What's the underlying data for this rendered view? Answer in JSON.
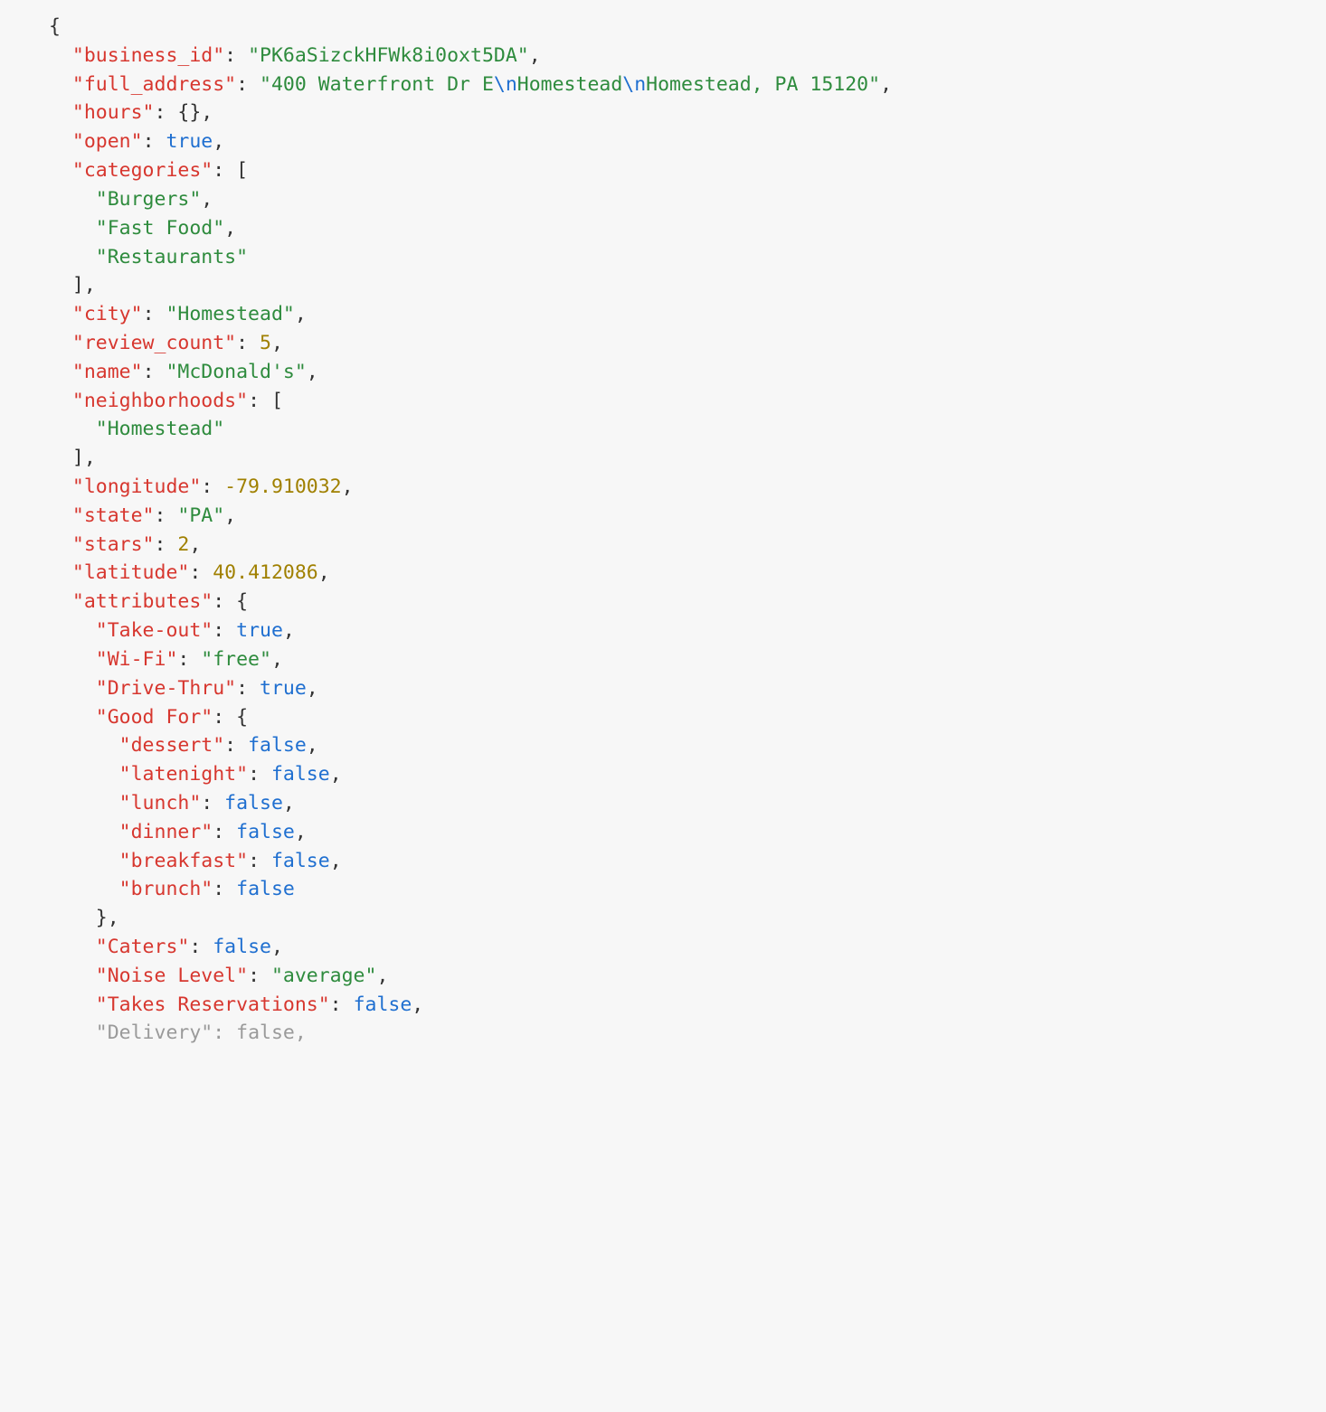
{
  "colors": {
    "punct": "#333333",
    "key": "#d7372f",
    "string": "#2e8b3d",
    "number": "#a08000",
    "boolean": "#1f6fd0",
    "escape": "#1f6fd0",
    "background": "#f7f7f7"
  },
  "json_data": {
    "business_id": "PK6aSizckHFWk8i0oxt5DA",
    "full_address": "400 Waterfront Dr E\nHomestead\nHomestead, PA 15120",
    "hours": {},
    "open": true,
    "categories": [
      "Burgers",
      "Fast Food",
      "Restaurants"
    ],
    "city": "Homestead",
    "review_count": 5,
    "name": "McDonald's",
    "neighborhoods": [
      "Homestead"
    ],
    "longitude": -79.910032,
    "state": "PA",
    "stars": 2,
    "latitude": 40.412086,
    "attributes": {
      "Take-out": true,
      "Wi-Fi": "free",
      "Drive-Thru": true,
      "Good For": {
        "dessert": false,
        "latenight": false,
        "lunch": false,
        "dinner": false,
        "breakfast": false,
        "brunch": false
      },
      "Caters": false,
      "Noise Level": "average",
      "Takes Reservations": false,
      "Delivery": false
    }
  },
  "tokens": [
    {
      "indent": 0,
      "parts": [
        {
          "t": "{",
          "c": "p"
        }
      ]
    },
    {
      "indent": 1,
      "parts": [
        {
          "t": "\"business_id\"",
          "c": "k"
        },
        {
          "t": ": ",
          "c": "p"
        },
        {
          "t": "\"PK6aSizckHFWk8i0oxt5DA\"",
          "c": "s"
        },
        {
          "t": ",",
          "c": "p"
        }
      ]
    },
    {
      "indent": 1,
      "parts": [
        {
          "t": "\"full_address\"",
          "c": "k"
        },
        {
          "t": ": ",
          "c": "p"
        },
        {
          "t": "\"400 Waterfront Dr E",
          "c": "s"
        },
        {
          "t": "\\n",
          "c": "e"
        },
        {
          "t": "Homestead",
          "c": "s"
        },
        {
          "t": "\\n",
          "c": "e"
        },
        {
          "t": "Homestead, PA 15120\"",
          "c": "s"
        },
        {
          "t": ",",
          "c": "p"
        }
      ]
    },
    {
      "indent": 1,
      "parts": [
        {
          "t": "\"hours\"",
          "c": "k"
        },
        {
          "t": ": ",
          "c": "p"
        },
        {
          "t": "{}",
          "c": "p"
        },
        {
          "t": ",",
          "c": "p"
        }
      ]
    },
    {
      "indent": 1,
      "parts": [
        {
          "t": "\"open\"",
          "c": "k"
        },
        {
          "t": ": ",
          "c": "p"
        },
        {
          "t": "true",
          "c": "b"
        },
        {
          "t": ",",
          "c": "p"
        }
      ]
    },
    {
      "indent": 1,
      "parts": [
        {
          "t": "\"categories\"",
          "c": "k"
        },
        {
          "t": ": ",
          "c": "p"
        },
        {
          "t": "[",
          "c": "p"
        }
      ]
    },
    {
      "indent": 2,
      "parts": [
        {
          "t": "\"Burgers\"",
          "c": "s"
        },
        {
          "t": ",",
          "c": "p"
        }
      ]
    },
    {
      "indent": 2,
      "parts": [
        {
          "t": "\"Fast Food\"",
          "c": "s"
        },
        {
          "t": ",",
          "c": "p"
        }
      ]
    },
    {
      "indent": 2,
      "parts": [
        {
          "t": "\"Restaurants\"",
          "c": "s"
        }
      ]
    },
    {
      "indent": 1,
      "parts": [
        {
          "t": "]",
          "c": "p"
        },
        {
          "t": ",",
          "c": "p"
        }
      ]
    },
    {
      "indent": 1,
      "parts": [
        {
          "t": "\"city\"",
          "c": "k"
        },
        {
          "t": ": ",
          "c": "p"
        },
        {
          "t": "\"Homestead\"",
          "c": "s"
        },
        {
          "t": ",",
          "c": "p"
        }
      ]
    },
    {
      "indent": 1,
      "parts": [
        {
          "t": "\"review_count\"",
          "c": "k"
        },
        {
          "t": ": ",
          "c": "p"
        },
        {
          "t": "5",
          "c": "n"
        },
        {
          "t": ",",
          "c": "p"
        }
      ]
    },
    {
      "indent": 1,
      "parts": [
        {
          "t": "\"name\"",
          "c": "k"
        },
        {
          "t": ": ",
          "c": "p"
        },
        {
          "t": "\"McDonald's\"",
          "c": "s"
        },
        {
          "t": ",",
          "c": "p"
        }
      ]
    },
    {
      "indent": 1,
      "parts": [
        {
          "t": "\"neighborhoods\"",
          "c": "k"
        },
        {
          "t": ": ",
          "c": "p"
        },
        {
          "t": "[",
          "c": "p"
        }
      ]
    },
    {
      "indent": 2,
      "parts": [
        {
          "t": "\"Homestead\"",
          "c": "s"
        }
      ]
    },
    {
      "indent": 1,
      "parts": [
        {
          "t": "]",
          "c": "p"
        },
        {
          "t": ",",
          "c": "p"
        }
      ]
    },
    {
      "indent": 1,
      "parts": [
        {
          "t": "\"longitude\"",
          "c": "k"
        },
        {
          "t": ": ",
          "c": "p"
        },
        {
          "t": "-79.910032",
          "c": "n"
        },
        {
          "t": ",",
          "c": "p"
        }
      ]
    },
    {
      "indent": 1,
      "parts": [
        {
          "t": "\"state\"",
          "c": "k"
        },
        {
          "t": ": ",
          "c": "p"
        },
        {
          "t": "\"PA\"",
          "c": "s"
        },
        {
          "t": ",",
          "c": "p"
        }
      ]
    },
    {
      "indent": 1,
      "parts": [
        {
          "t": "\"stars\"",
          "c": "k"
        },
        {
          "t": ": ",
          "c": "p"
        },
        {
          "t": "2",
          "c": "n"
        },
        {
          "t": ",",
          "c": "p"
        }
      ]
    },
    {
      "indent": 1,
      "parts": [
        {
          "t": "\"latitude\"",
          "c": "k"
        },
        {
          "t": ": ",
          "c": "p"
        },
        {
          "t": "40.412086",
          "c": "n"
        },
        {
          "t": ",",
          "c": "p"
        }
      ]
    },
    {
      "indent": 1,
      "parts": [
        {
          "t": "\"attributes\"",
          "c": "k"
        },
        {
          "t": ": ",
          "c": "p"
        },
        {
          "t": "{",
          "c": "p"
        }
      ]
    },
    {
      "indent": 2,
      "parts": [
        {
          "t": "\"Take-out\"",
          "c": "k"
        },
        {
          "t": ": ",
          "c": "p"
        },
        {
          "t": "true",
          "c": "b"
        },
        {
          "t": ",",
          "c": "p"
        }
      ]
    },
    {
      "indent": 2,
      "parts": [
        {
          "t": "\"Wi-Fi\"",
          "c": "k"
        },
        {
          "t": ": ",
          "c": "p"
        },
        {
          "t": "\"free\"",
          "c": "s"
        },
        {
          "t": ",",
          "c": "p"
        }
      ]
    },
    {
      "indent": 2,
      "parts": [
        {
          "t": "\"Drive-Thru\"",
          "c": "k"
        },
        {
          "t": ": ",
          "c": "p"
        },
        {
          "t": "true",
          "c": "b"
        },
        {
          "t": ",",
          "c": "p"
        }
      ]
    },
    {
      "indent": 2,
      "parts": [
        {
          "t": "\"Good For\"",
          "c": "k"
        },
        {
          "t": ": ",
          "c": "p"
        },
        {
          "t": "{",
          "c": "p"
        }
      ]
    },
    {
      "indent": 3,
      "parts": [
        {
          "t": "\"dessert\"",
          "c": "k"
        },
        {
          "t": ": ",
          "c": "p"
        },
        {
          "t": "false",
          "c": "b"
        },
        {
          "t": ",",
          "c": "p"
        }
      ]
    },
    {
      "indent": 3,
      "parts": [
        {
          "t": "\"latenight\"",
          "c": "k"
        },
        {
          "t": ": ",
          "c": "p"
        },
        {
          "t": "false",
          "c": "b"
        },
        {
          "t": ",",
          "c": "p"
        }
      ]
    },
    {
      "indent": 3,
      "parts": [
        {
          "t": "\"lunch\"",
          "c": "k"
        },
        {
          "t": ": ",
          "c": "p"
        },
        {
          "t": "false",
          "c": "b"
        },
        {
          "t": ",",
          "c": "p"
        }
      ]
    },
    {
      "indent": 3,
      "parts": [
        {
          "t": "\"dinner\"",
          "c": "k"
        },
        {
          "t": ": ",
          "c": "p"
        },
        {
          "t": "false",
          "c": "b"
        },
        {
          "t": ",",
          "c": "p"
        }
      ]
    },
    {
      "indent": 3,
      "parts": [
        {
          "t": "\"breakfast\"",
          "c": "k"
        },
        {
          "t": ": ",
          "c": "p"
        },
        {
          "t": "false",
          "c": "b"
        },
        {
          "t": ",",
          "c": "p"
        }
      ]
    },
    {
      "indent": 3,
      "parts": [
        {
          "t": "\"brunch\"",
          "c": "k"
        },
        {
          "t": ": ",
          "c": "p"
        },
        {
          "t": "false",
          "c": "b"
        }
      ]
    },
    {
      "indent": 2,
      "parts": [
        {
          "t": "}",
          "c": "p"
        },
        {
          "t": ",",
          "c": "p"
        }
      ]
    },
    {
      "indent": 2,
      "parts": [
        {
          "t": "\"Caters\"",
          "c": "k"
        },
        {
          "t": ": ",
          "c": "p"
        },
        {
          "t": "false",
          "c": "b"
        },
        {
          "t": ",",
          "c": "p"
        }
      ]
    },
    {
      "indent": 2,
      "parts": [
        {
          "t": "\"Noise Level\"",
          "c": "k"
        },
        {
          "t": ": ",
          "c": "p"
        },
        {
          "t": "\"average\"",
          "c": "s"
        },
        {
          "t": ",",
          "c": "p"
        }
      ]
    },
    {
      "indent": 2,
      "parts": [
        {
          "t": "\"Takes Reservations\"",
          "c": "k"
        },
        {
          "t": ": ",
          "c": "p"
        },
        {
          "t": "false",
          "c": "b"
        },
        {
          "t": ",",
          "c": "p"
        }
      ]
    },
    {
      "indent": 2,
      "parts": [
        {
          "t": "\"Delivery\"",
          "c": "k"
        },
        {
          "t": ": ",
          "c": "p"
        },
        {
          "t": "false",
          "c": "b"
        },
        {
          "t": ",",
          "c": "p"
        }
      ],
      "faded": true
    }
  ]
}
